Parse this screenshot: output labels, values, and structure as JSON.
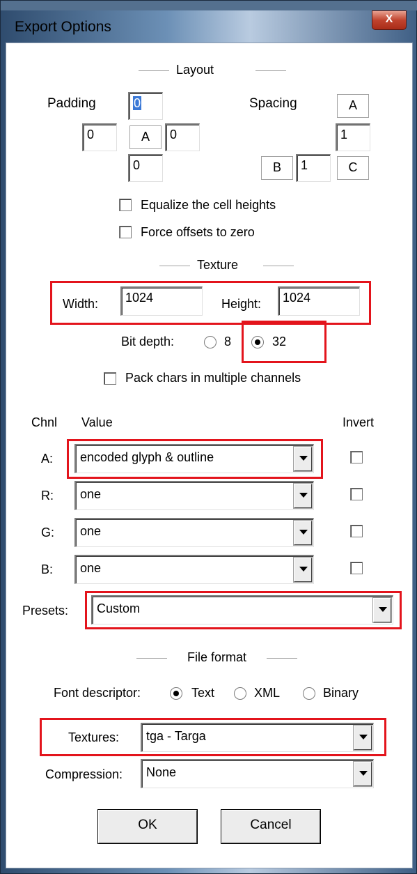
{
  "window": {
    "title": "Export Options",
    "close_label": "X"
  },
  "layout": {
    "section_label": "Layout",
    "padding_label": "Padding",
    "padding_top": "0",
    "padding_left": "0",
    "padding_center_label": "A",
    "padding_right": "0",
    "padding_bottom": "0",
    "spacing_label": "Spacing",
    "spacing_a_label": "A",
    "spacing_vertical": "1",
    "spacing_b_label": "B",
    "spacing_horizontal": "1",
    "spacing_c_label": "C",
    "equalize_label": "Equalize the cell heights",
    "equalize_checked": false,
    "force_offsets_label": "Force offsets to zero",
    "force_offsets_checked": false
  },
  "texture": {
    "section_label": "Texture",
    "width_label": "Width:",
    "width_value": "1024",
    "height_label": "Height:",
    "height_value": "1024",
    "bit_depth_label": "Bit depth:",
    "bit_depth_options": [
      "8",
      "32"
    ],
    "bit_depth_selected": "32",
    "pack_label": "Pack chars in multiple channels",
    "pack_checked": false
  },
  "channels": {
    "header_chnl": "Chnl",
    "header_value": "Value",
    "header_invert": "Invert",
    "rows": [
      {
        "label": "A:",
        "value": "encoded glyph & outline",
        "invert": false
      },
      {
        "label": "R:",
        "value": "one",
        "invert": false
      },
      {
        "label": "G:",
        "value": "one",
        "invert": false
      },
      {
        "label": "B:",
        "value": "one",
        "invert": false
      }
    ]
  },
  "presets": {
    "label": "Presets:",
    "value": "Custom"
  },
  "file_format": {
    "section_label": "File format",
    "descriptor_label": "Font descriptor:",
    "descriptor_options": [
      "Text",
      "XML",
      "Binary"
    ],
    "descriptor_selected": "Text",
    "textures_label": "Textures:",
    "textures_value": "tga - Targa",
    "compression_label": "Compression:",
    "compression_value": "None"
  },
  "buttons": {
    "ok_label": "OK",
    "cancel_label": "Cancel"
  },
  "colors": {
    "highlight": "#e3141c",
    "title_bar": "#6c90b6",
    "close_button": "#c0432e"
  }
}
